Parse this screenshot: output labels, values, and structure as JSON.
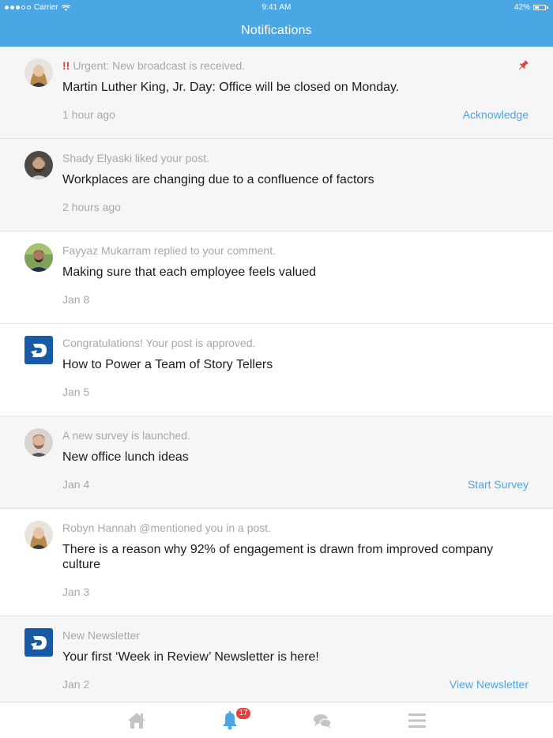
{
  "status_bar": {
    "carrier": "Carrier",
    "time": "9:41 AM",
    "battery": "42%"
  },
  "header": {
    "title": "Notifications"
  },
  "notifications": [
    {
      "meta_prefix": "!!",
      "meta": "Urgent: New broadcast is received.",
      "headline": "Martin Luther King, Jr. Day: Office will be closed on Monday.",
      "time": "1 hour ago",
      "action": "Acknowledge",
      "avatar": "photo-woman",
      "pinned": true
    },
    {
      "meta": "Shady Elyaski liked your post.",
      "headline": "Workplaces are changing due to a confluence of factors",
      "time": "2 hours ago",
      "action": "",
      "avatar": "photo-man-beard"
    },
    {
      "meta": "Fayyaz Mukarram replied to your comment.",
      "headline": "Making sure that each employee feels valued",
      "time": "Jan 8",
      "action": "",
      "avatar": "photo-man-outdoor"
    },
    {
      "meta": "Congratulations! Your post is approved.",
      "headline": "How to Power a Team of Story Tellers",
      "time": "Jan 5",
      "action": "",
      "avatar": "app-logo"
    },
    {
      "meta": "A new survey is launched.",
      "headline": "New office lunch ideas",
      "time": "Jan 4",
      "action": "Start Survey",
      "avatar": "photo-man-smile"
    },
    {
      "meta": "Robyn Hannah @mentioned you in a post.",
      "headline": "There is a reason why 92% of engagement is drawn from improved company culture",
      "time": "Jan 3",
      "action": "",
      "avatar": "photo-woman"
    },
    {
      "meta": "New Newsletter",
      "headline": "Your first ‘Week in Review’ Newsletter is here!",
      "time": "Jan 2",
      "action": "View Newsletter",
      "avatar": "app-logo"
    }
  ],
  "tabbar": {
    "tabs": [
      "home-icon",
      "bell-icon",
      "chat-icon",
      "menu-icon"
    ],
    "active": "bell-icon",
    "badge_count": "17"
  },
  "colors": {
    "accent": "#4aa7e3",
    "urgent": "#e23b3b",
    "badge": "#e8403e",
    "unread_bg": "#f6f6f6"
  }
}
